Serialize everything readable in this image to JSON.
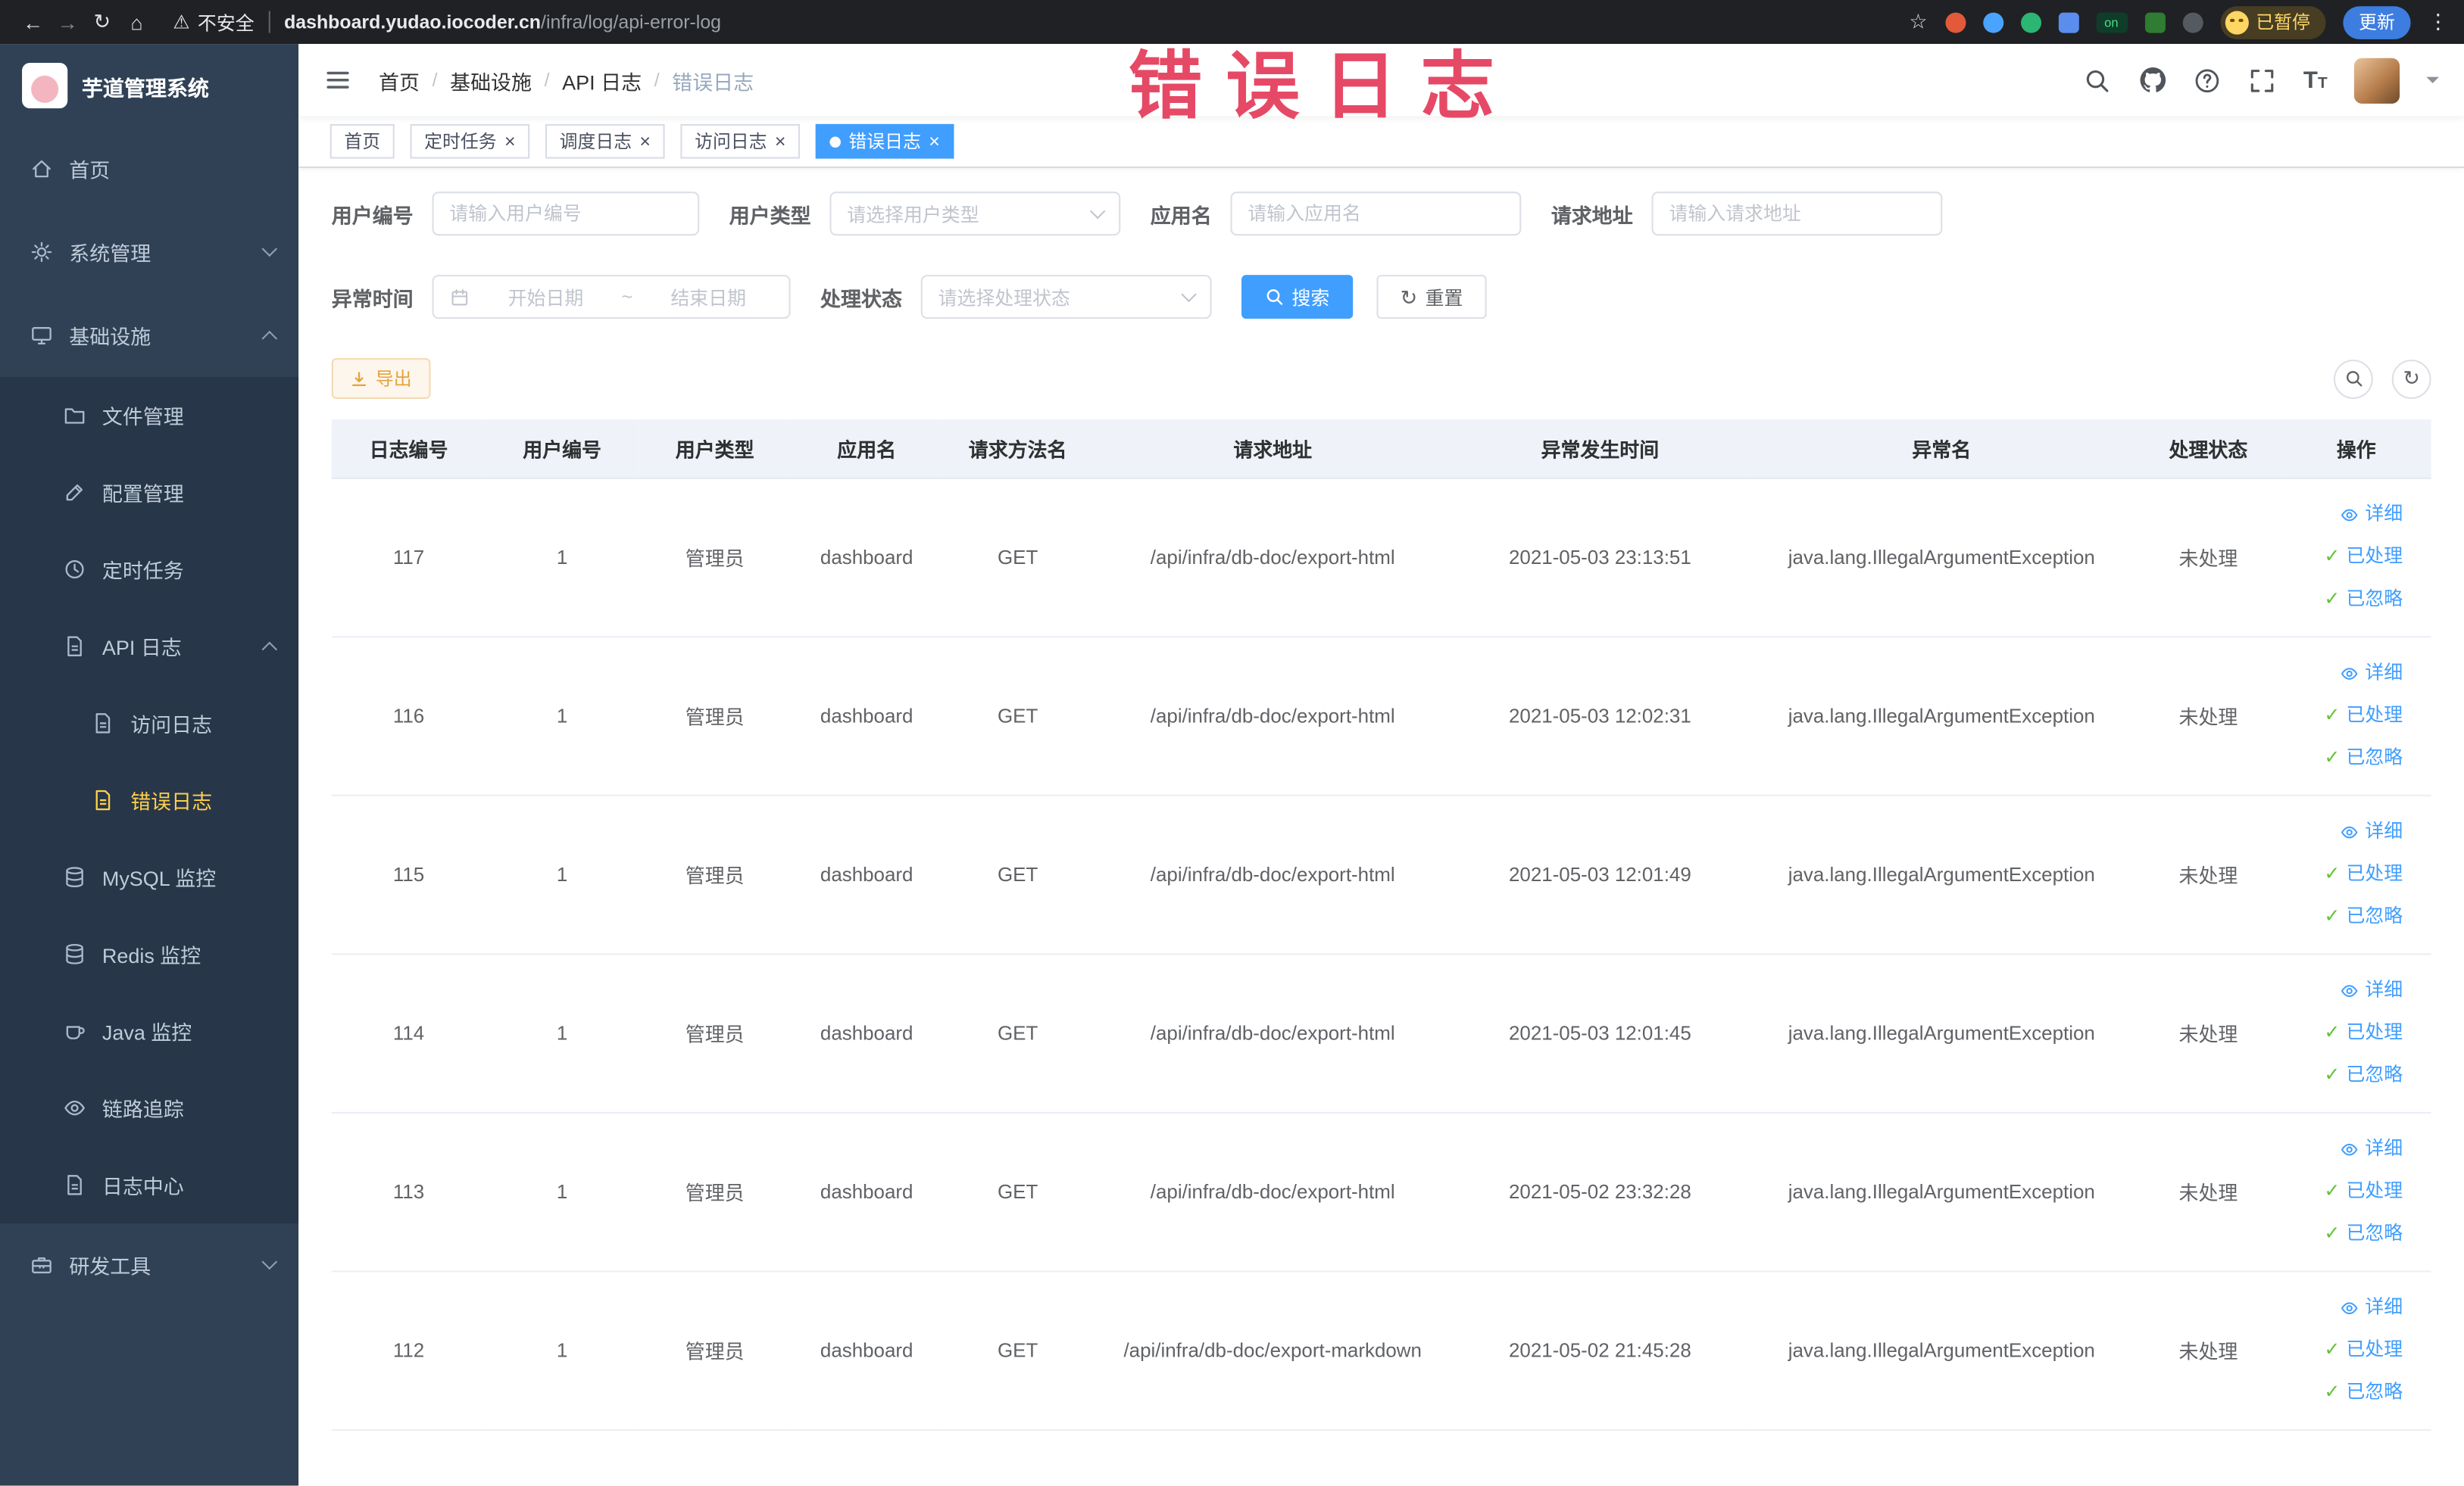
{
  "browser": {
    "security_label": "不安全",
    "url_host": "dashboard.yudao.iocoder.cn",
    "url_path": "/infra/log/api-error-log",
    "paused_badge": "已暂停",
    "update_button": "更新"
  },
  "sidebar": {
    "logo_title": "芋道管理系统",
    "items": {
      "home": "首页",
      "system": "系统管理",
      "infra": "基础设施",
      "file_manage": "文件管理",
      "config_manage": "配置管理",
      "scheduled_jobs": "定时任务",
      "api_log": "API 日志",
      "access_log": "访问日志",
      "error_log": "错误日志",
      "mysql_monitor": "MySQL 监控",
      "redis_monitor": "Redis 监控",
      "java_monitor": "Java 监控",
      "trace": "链路追踪",
      "log_center": "日志中心",
      "dev_tools": "研发工具"
    }
  },
  "navbar": {
    "breadcrumb": [
      "首页",
      "基础设施",
      "API 日志",
      "错误日志"
    ]
  },
  "annotation": "错误日志",
  "tabs": [
    "首页",
    "定时任务",
    "调度日志",
    "访问日志",
    "错误日志"
  ],
  "filters": {
    "user_id_label": "用户编号",
    "user_id_placeholder": "请输入用户编号",
    "user_type_label": "用户类型",
    "user_type_placeholder": "请选择用户类型",
    "app_name_label": "应用名",
    "app_name_placeholder": "请输入应用名",
    "request_url_label": "请求地址",
    "request_url_placeholder": "请输入请求地址",
    "exception_time_label": "异常时间",
    "date_start_placeholder": "开始日期",
    "date_separator": "~",
    "date_end_placeholder": "结束日期",
    "status_label": "处理状态",
    "status_placeholder": "请选择处理状态",
    "search_button": "搜索",
    "reset_button": "重置"
  },
  "toolbar": {
    "export_button": "导出"
  },
  "table": {
    "headers": [
      "日志编号",
      "用户编号",
      "用户类型",
      "应用名",
      "请求方法名",
      "请求地址",
      "异常发生时间",
      "异常名",
      "处理状态",
      "操作"
    ],
    "actions": [
      "详细",
      "已处理",
      "已忽略"
    ],
    "rows": [
      {
        "id": "117",
        "user_id": "1",
        "user_type": "管理员",
        "app": "dashboard",
        "method": "GET",
        "url": "/api/infra/db-doc/export-html",
        "time": "2021-05-03 23:13:51",
        "exception": "java.lang.IllegalArgumentException",
        "status": "未处理"
      },
      {
        "id": "116",
        "user_id": "1",
        "user_type": "管理员",
        "app": "dashboard",
        "method": "GET",
        "url": "/api/infra/db-doc/export-html",
        "time": "2021-05-03 12:02:31",
        "exception": "java.lang.IllegalArgumentException",
        "status": "未处理"
      },
      {
        "id": "115",
        "user_id": "1",
        "user_type": "管理员",
        "app": "dashboard",
        "method": "GET",
        "url": "/api/infra/db-doc/export-html",
        "time": "2021-05-03 12:01:49",
        "exception": "java.lang.IllegalArgumentException",
        "status": "未处理"
      },
      {
        "id": "114",
        "user_id": "1",
        "user_type": "管理员",
        "app": "dashboard",
        "method": "GET",
        "url": "/api/infra/db-doc/export-html",
        "time": "2021-05-03 12:01:45",
        "exception": "java.lang.IllegalArgumentException",
        "status": "未处理"
      },
      {
        "id": "113",
        "user_id": "1",
        "user_type": "管理员",
        "app": "dashboard",
        "method": "GET",
        "url": "/api/infra/db-doc/export-html",
        "time": "2021-05-02 23:32:28",
        "exception": "java.lang.IllegalArgumentException",
        "status": "未处理"
      },
      {
        "id": "112",
        "user_id": "1",
        "user_type": "管理员",
        "app": "dashboard",
        "method": "GET",
        "url": "/api/infra/db-doc/export-markdown",
        "time": "2021-05-02 21:45:28",
        "exception": "java.lang.IllegalArgumentException",
        "status": "未处理"
      }
    ]
  },
  "colors": {
    "primary": "#409eff",
    "sidebar_bg": "#304156",
    "menu_active": "#ffd04b",
    "annotation": "#e64965"
  }
}
